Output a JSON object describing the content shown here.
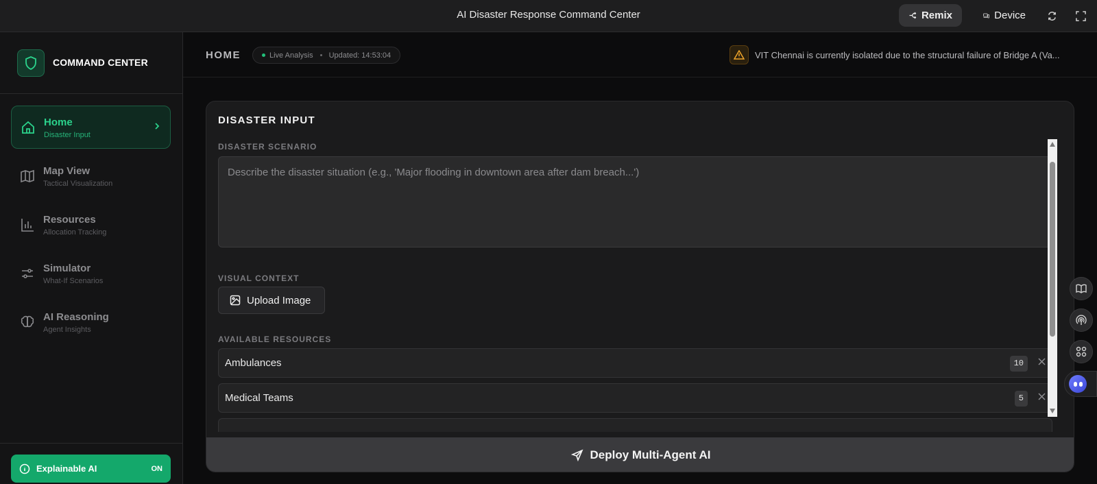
{
  "app": {
    "title": "AI Disaster Response Command Center",
    "remix_label": "Remix",
    "device_label": "Device"
  },
  "brand": {
    "name": "COMMAND CENTER"
  },
  "sidebar": {
    "items": [
      {
        "label": "Home",
        "sub": "Disaster Input",
        "icon": "home-icon",
        "active": true
      },
      {
        "label": "Map View",
        "sub": "Tactical Visualization",
        "icon": "map-icon"
      },
      {
        "label": "Resources",
        "sub": "Allocation Tracking",
        "icon": "bar-chart-icon"
      },
      {
        "label": "Simulator",
        "sub": "What-If Scenarios",
        "icon": "sliders-icon"
      },
      {
        "label": "AI Reasoning",
        "sub": "Agent Insights",
        "icon": "brain-icon"
      }
    ],
    "footer": {
      "label": "Explainable AI",
      "state": "ON"
    }
  },
  "header": {
    "page_title": "HOME",
    "live_label": "Live Analysis",
    "updated_label": "Updated: 14:53:04",
    "alert_text": "VIT Chennai is currently isolated due to the structural failure of Bridge A (Va..."
  },
  "card": {
    "title": "DISASTER INPUT",
    "scenario_label": "DISASTER SCENARIO",
    "scenario_placeholder": "Describe the disaster situation (e.g., 'Major flooding in downtown area after dam breach...')",
    "visual_label": "VISUAL CONTEXT",
    "upload_label": "Upload Image",
    "resources_label": "AVAILABLE RESOURCES",
    "resources": [
      {
        "name": "Ambulances",
        "count": "10"
      },
      {
        "name": "Medical Teams",
        "count": "5"
      }
    ],
    "deploy_label": "Deploy Multi-Agent AI"
  },
  "colors": {
    "accent": "#2bd38c",
    "toggle": "#14a86b",
    "warning": "#f0a52a",
    "background": "#0c0c0d"
  }
}
